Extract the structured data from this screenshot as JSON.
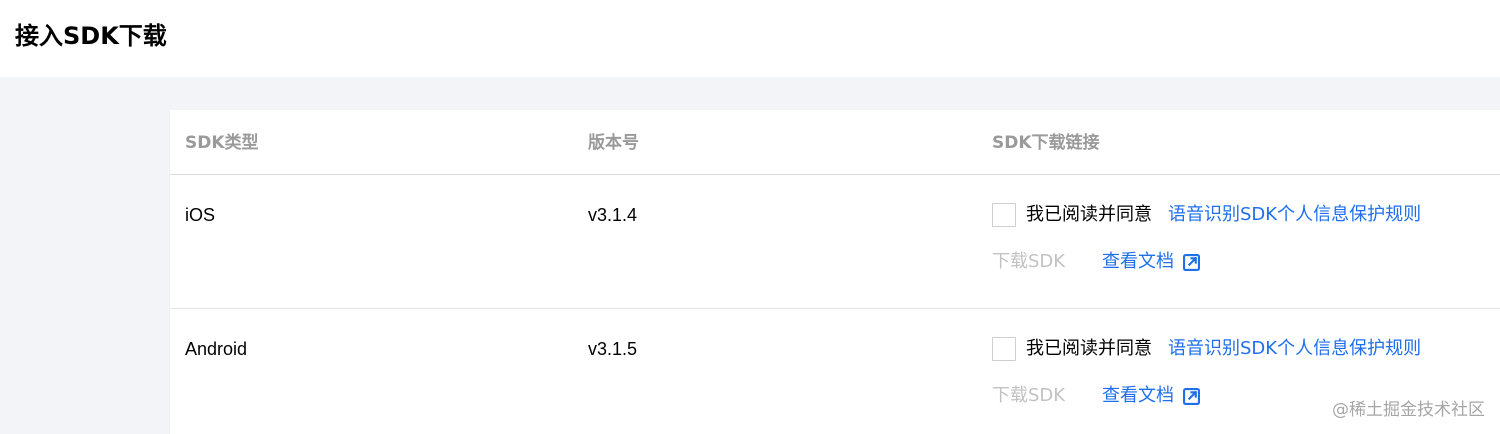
{
  "page": {
    "title": "接入SDK下载"
  },
  "table": {
    "headers": [
      "SDK类型",
      "版本号",
      "SDK下载链接"
    ],
    "rows": [
      {
        "type": "iOS",
        "version": "v3.1.4",
        "agree_text": "我已阅读并同意",
        "policy_link": "语音识别SDK个人信息保护规则",
        "download_label": "下载SDK",
        "doc_link": "查看文档",
        "checked": false
      },
      {
        "type": "Android",
        "version": "v3.1.5",
        "agree_text": "我已阅读并同意",
        "policy_link": "语音识别SDK个人信息保护规则",
        "download_label": "下载SDK",
        "doc_link": "查看文档",
        "checked": false
      }
    ]
  },
  "watermark": "@稀土掘金技术社区",
  "colors": {
    "link": "#1f6feb",
    "disabled": "#c2c2c2",
    "header_text": "#9a9a9a",
    "page_bg": "#f2f4f8"
  },
  "icons": {
    "doc_link": "external-link-icon"
  }
}
